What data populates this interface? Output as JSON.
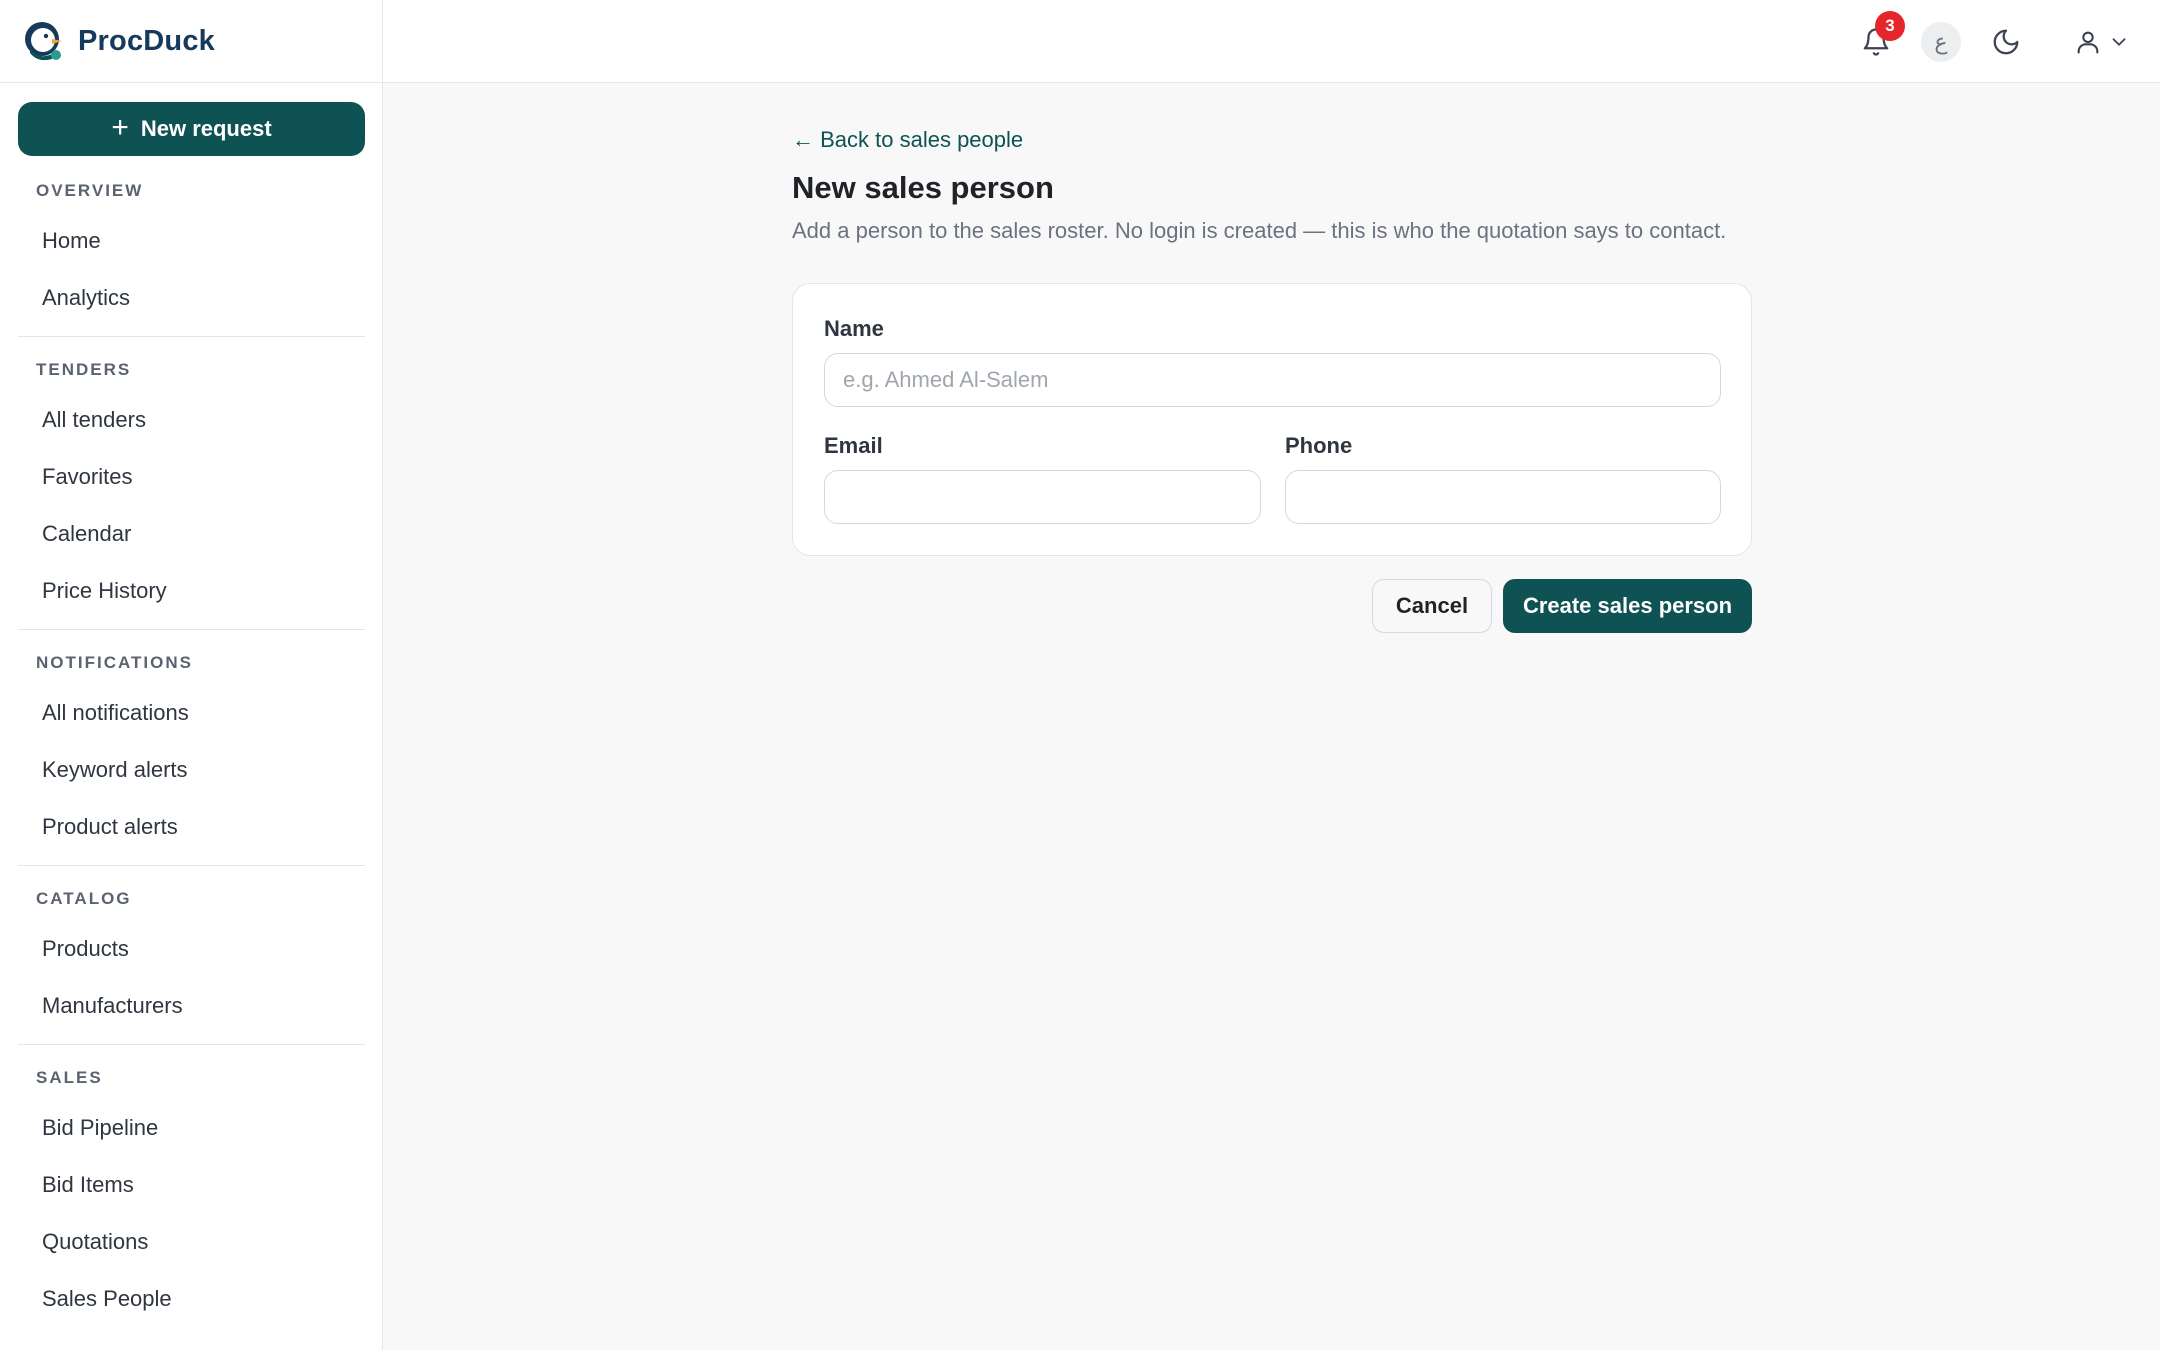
{
  "app": {
    "name": "ProcDuck"
  },
  "sidebar": {
    "new_request_label": "New request",
    "sections": [
      {
        "title": "OVERVIEW",
        "items": [
          "Home",
          "Analytics"
        ]
      },
      {
        "title": "TENDERS",
        "items": [
          "All tenders",
          "Favorites",
          "Calendar",
          "Price History"
        ]
      },
      {
        "title": "NOTIFICATIONS",
        "items": [
          "All notifications",
          "Keyword alerts",
          "Product alerts"
        ]
      },
      {
        "title": "CATALOG",
        "items": [
          "Products",
          "Manufacturers"
        ]
      },
      {
        "title": "SALES",
        "items": [
          "Bid Pipeline",
          "Bid Items",
          "Quotations",
          "Sales People"
        ]
      }
    ]
  },
  "topbar": {
    "notification_count": "3",
    "language_glyph": "ع",
    "icons": [
      "bell-icon",
      "moon-icon",
      "user-icon",
      "chevron-down-icon"
    ]
  },
  "page": {
    "back_link": "← Back to sales people",
    "title": "New sales person",
    "description": "Add a person to the sales roster. No login is created — this is who the quotation says to contact."
  },
  "form": {
    "name_label": "Name",
    "name_placeholder": "e.g. Ahmed Al-Salem",
    "name_value": "",
    "email_label": "Email",
    "email_value": "",
    "phone_label": "Phone",
    "phone_value": ""
  },
  "actions": {
    "cancel_label": "Cancel",
    "create_label": "Create sales person"
  },
  "colors": {
    "accent": "#0f5253",
    "badge": "#e5252a",
    "brand_text": "#163a5c"
  }
}
